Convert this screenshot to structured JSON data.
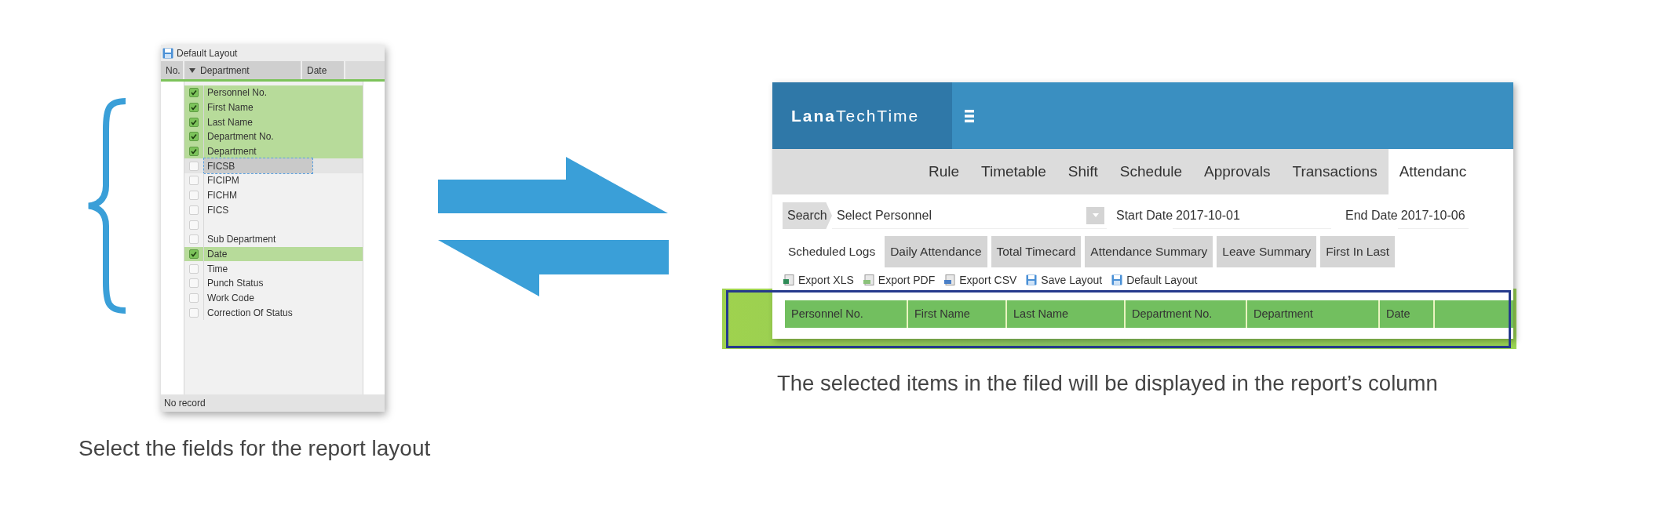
{
  "left_panel": {
    "title": "Default Layout",
    "columns": [
      {
        "label": "No.",
        "sorted": false
      },
      {
        "label": "Department",
        "sorted": true
      },
      {
        "label": "Date",
        "sorted": false
      }
    ],
    "fields": [
      {
        "label": "Personnel No.",
        "checked": true,
        "selected": false
      },
      {
        "label": "First Name",
        "checked": true,
        "selected": false
      },
      {
        "label": "Last Name",
        "checked": true,
        "selected": false
      },
      {
        "label": "Department No.",
        "checked": true,
        "selected": false
      },
      {
        "label": "Department",
        "checked": true,
        "selected": false
      },
      {
        "label": "FICSB",
        "checked": false,
        "selected": true
      },
      {
        "label": "FICIPM",
        "checked": false,
        "selected": false
      },
      {
        "label": "FICHM",
        "checked": false,
        "selected": false
      },
      {
        "label": "FICS",
        "checked": false,
        "selected": false
      },
      {
        "checked": false,
        "selected": false
      },
      {
        "label": "Sub Department",
        "checked": false,
        "selected": false
      },
      {
        "label": "Date",
        "checked": true,
        "selected": false
      },
      {
        "label": "Time",
        "checked": false,
        "selected": false
      },
      {
        "label": "Punch Status",
        "checked": false,
        "selected": false
      },
      {
        "label": "Work Code",
        "checked": false,
        "selected": false
      },
      {
        "label": "Correction Of Status",
        "checked": false,
        "selected": false
      }
    ],
    "status": "No record"
  },
  "left_caption": "Select the fields for the report layout",
  "app": {
    "brand": "**Lana**TechTime",
    "nav_tabs": [
      {
        "label": "Rule",
        "selected": false
      },
      {
        "label": "Timetable",
        "selected": false
      },
      {
        "label": "Shift",
        "selected": false
      },
      {
        "label": "Schedule",
        "selected": false
      },
      {
        "label": "Approvals",
        "selected": false
      },
      {
        "label": "Transactions",
        "selected": false
      },
      {
        "label": "Attendanc",
        "selected": true
      }
    ],
    "search": {
      "label": "Search",
      "value": "Select Personnel",
      "start_date_label": "Start Date",
      "start_date": "2017-10-01",
      "end_date_label": "End Date",
      "end_date": "2017-10-06"
    },
    "report_tabs": [
      {
        "label": "Scheduled Logs",
        "selected": true
      },
      {
        "label": "Daily Attendance",
        "selected": false
      },
      {
        "label": "Total Timecard",
        "selected": false
      },
      {
        "label": "Attendance Summary",
        "selected": false
      },
      {
        "label": "Leave Summary",
        "selected": false
      },
      {
        "label": "First In Last",
        "selected": false
      }
    ],
    "toolbar": [
      {
        "label": "Export XLS",
        "kind": "xls"
      },
      {
        "label": "Export PDF",
        "kind": "pdf"
      },
      {
        "label": "Export CSV",
        "kind": "csv"
      },
      {
        "label": "Save Layout",
        "kind": "save"
      },
      {
        "label": "Default Layout",
        "kind": "save"
      }
    ],
    "columns": [
      "Personnel No.",
      "First Name",
      "Last Name",
      "Department No.",
      "Department",
      "Date"
    ]
  },
  "right_caption": "The selected items in the filed will be displayed in the report’s column"
}
